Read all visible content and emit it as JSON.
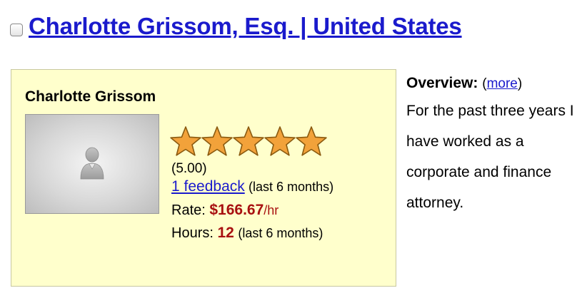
{
  "header": {
    "title": "Charlotte Grissom, Esq. | United States"
  },
  "card": {
    "name": "Charlotte Grissom",
    "avatar_icon": "user-silhouette-icon",
    "rating": 5.0,
    "rating_text": "(5.00)",
    "star_count": 5,
    "star_color": "#f0a030",
    "feedback_link": "1 feedback",
    "feedback_note": "(last 6 months)",
    "rate_label": "Rate:",
    "rate_value": "$166.67",
    "rate_unit": "/hr",
    "hours_label": "Hours:",
    "hours_value": "12",
    "hours_note": "(last 6 months)"
  },
  "overview": {
    "label": "Overview:",
    "more_open": "(",
    "more_link": "more",
    "more_close": ")",
    "text": "For the past three years I have worked as a corporate and finance attorney."
  },
  "colors": {
    "link": "#1a1acc",
    "card_bg": "#ffffcc",
    "accent_red": "#a81010"
  }
}
